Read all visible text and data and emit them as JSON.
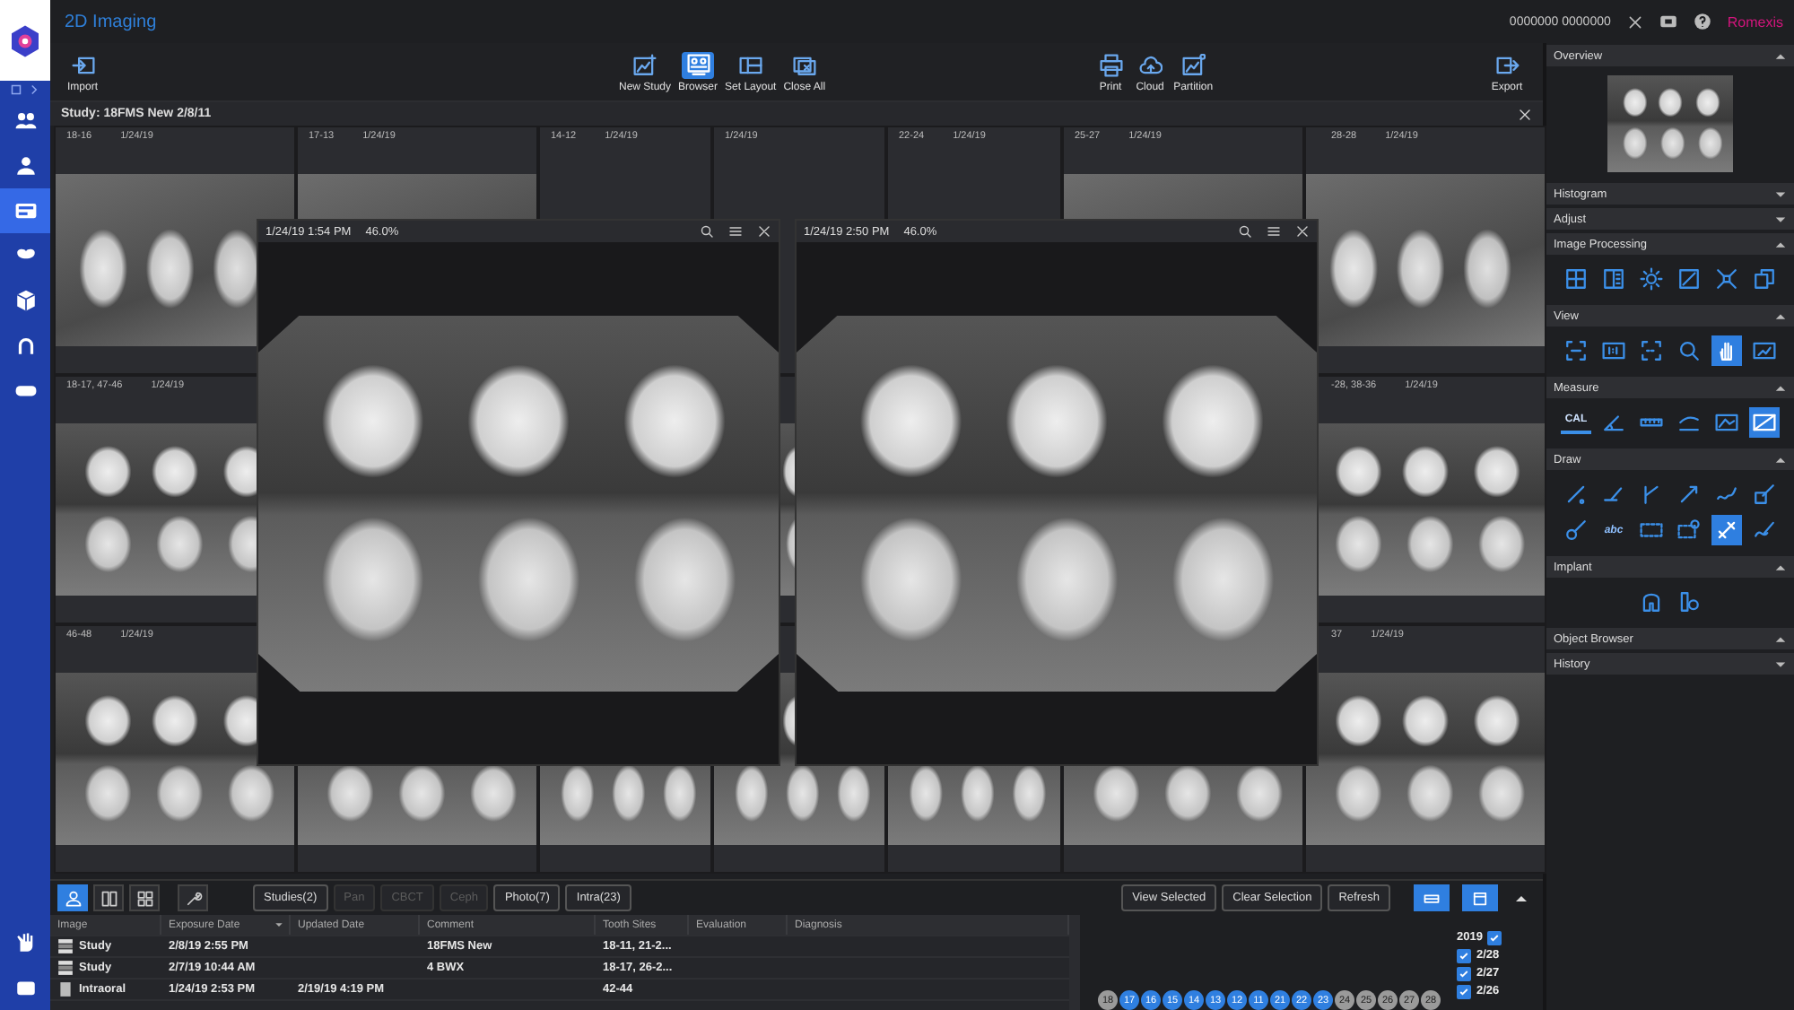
{
  "app": {
    "title": "2D Imaging",
    "user_id": "0000000 0000000",
    "brand": "Romexis"
  },
  "nav": {
    "items": [
      {
        "kind": "group",
        "selected": false
      },
      {
        "kind": "person",
        "selected": false
      },
      {
        "kind": "browser",
        "selected": true
      },
      {
        "kind": "tooth",
        "selected": false
      },
      {
        "kind": "cube",
        "selected": false
      },
      {
        "kind": "arch",
        "selected": false
      },
      {
        "kind": "scan",
        "selected": false
      }
    ],
    "footer": [
      {
        "kind": "hand",
        "selected": false
      },
      {
        "kind": "film",
        "selected": false
      }
    ]
  },
  "toolbar": {
    "groups": [
      [
        {
          "kind": "import",
          "label": "Import",
          "selected": false
        }
      ],
      [
        {
          "kind": "new-study",
          "label": "New Study",
          "selected": false
        },
        {
          "kind": "browser",
          "label": "Browser",
          "selected": true
        },
        {
          "kind": "set-layout",
          "label": "Set Layout",
          "selected": false
        },
        {
          "kind": "close-all",
          "label": "Close All",
          "selected": false
        }
      ],
      [
        {
          "kind": "print",
          "label": "Print",
          "selected": false
        },
        {
          "kind": "cloud",
          "label": "Cloud",
          "selected": false
        },
        {
          "kind": "partition",
          "label": "Partition",
          "selected": false
        }
      ],
      [
        {
          "kind": "export",
          "label": "Export",
          "selected": false
        }
      ]
    ]
  },
  "study": {
    "title": "Study: 18FMS New  2/8/11",
    "rows": [
      [
        {
          "teeth": "18-16",
          "date": "1/24/19",
          "kind": "image"
        },
        {
          "teeth": "17-13",
          "date": "1/24/19",
          "kind": "image"
        },
        {
          "teeth": "14-12",
          "date": "1/24/19",
          "kind": "empty"
        },
        {
          "date": "1/24/19",
          "kind": "empty"
        },
        {
          "teeth": "22-24",
          "date": "1/24/19",
          "kind": "empty"
        },
        {
          "teeth": "25-27",
          "date": "1/24/19",
          "kind": "image"
        },
        {
          "teeth": "28-28",
          "date": "1/24/19",
          "kind": "image"
        }
      ],
      [
        {
          "teeth": "18-17, 47-46",
          "date": "1/24/19",
          "kind": "image"
        },
        {},
        {},
        {
          "kind": "image"
        },
        {},
        {},
        {
          "teeth": "-28, 38-36",
          "date": "1/24/19",
          "kind": "image"
        }
      ],
      [
        {
          "teeth": "46-48",
          "date": "1/24/19",
          "kind": "image"
        },
        {
          "kind": "image"
        },
        {
          "kind": "image"
        },
        {
          "kind": "image"
        },
        {
          "kind": "image"
        },
        {
          "kind": "image"
        },
        {
          "teeth": "37",
          "date": "1/24/19",
          "kind": "image"
        }
      ]
    ]
  },
  "viewers": [
    {
      "date": "1/24/19 1:54 PM",
      "zoom": "46.0%"
    },
    {
      "date": "1/24/19 2:50 PM",
      "zoom": "46.0%"
    }
  ],
  "overview": {
    "title": "Overview",
    "expanded": true
  },
  "panels": [
    {
      "title": "Histogram",
      "expanded": false
    },
    {
      "title": "Adjust",
      "expanded": false
    },
    {
      "title": "Image Processing",
      "expanded": true,
      "tools": [
        {
          "kind": "filter",
          "selected": false
        },
        {
          "kind": "split",
          "selected": false
        },
        {
          "kind": "brightness",
          "selected": false
        },
        {
          "kind": "contrast",
          "selected": false
        },
        {
          "kind": "flip",
          "selected": false
        },
        {
          "kind": "layers",
          "selected": false
        }
      ]
    },
    {
      "title": "View",
      "expanded": true,
      "tools": [
        {
          "kind": "fit",
          "selected": false
        },
        {
          "kind": "actual",
          "selected": false
        },
        {
          "kind": "fitdash",
          "selected": false
        },
        {
          "kind": "zoom",
          "selected": false
        },
        {
          "kind": "hand",
          "selected": true
        },
        {
          "kind": "picture",
          "selected": false
        }
      ]
    },
    {
      "title": "Measure",
      "expanded": true,
      "tools": [
        {
          "kind": "calibrate",
          "text": "CAL",
          "selected": false
        },
        {
          "kind": "angle",
          "selected": false
        },
        {
          "kind": "ruler",
          "selected": false
        },
        {
          "kind": "profile",
          "selected": false
        },
        {
          "kind": "area",
          "selected": false
        },
        {
          "kind": "slash",
          "selected": true
        }
      ]
    },
    {
      "title": "Draw",
      "expanded": true,
      "tools": [
        {
          "kind": "pen",
          "selected": false
        },
        {
          "kind": "line",
          "selected": false
        },
        {
          "kind": "polyline",
          "selected": false
        },
        {
          "kind": "arrow",
          "selected": false
        },
        {
          "kind": "curve",
          "selected": false
        },
        {
          "kind": "rectpen",
          "selected": false
        },
        {
          "kind": "circle",
          "selected": false
        },
        {
          "kind": "text",
          "text": "abc",
          "selected": false
        },
        {
          "kind": "dashed",
          "selected": false
        },
        {
          "kind": "dashedpin",
          "selected": false
        },
        {
          "kind": "diagonal",
          "selected": true
        },
        {
          "kind": "freehand",
          "selected": false
        }
      ]
    },
    {
      "title": "Implant",
      "expanded": true,
      "tools": [
        {
          "kind": "implant",
          "selected": false
        },
        {
          "kind": "implantpin",
          "selected": false
        }
      ]
    },
    {
      "title": "Object Browser",
      "expanded": true
    },
    {
      "title": "History",
      "expanded": false
    }
  ],
  "browser": {
    "view_modes": [
      {
        "kind": "patient",
        "selected": true
      },
      {
        "kind": "grid2",
        "selected": false
      },
      {
        "kind": "grid4",
        "selected": false
      },
      {
        "kind": "tools",
        "selected": false
      }
    ],
    "filters": [
      {
        "label": "Studies(2)",
        "disabled": false
      },
      {
        "label": "Pan",
        "disabled": true
      },
      {
        "label": "CBCT",
        "disabled": true
      },
      {
        "label": "Ceph",
        "disabled": true
      },
      {
        "label": "Photo(7)",
        "disabled": false
      },
      {
        "label": "Intra(23)",
        "disabled": false
      }
    ],
    "actions": [
      "View Selected",
      "Clear Selection",
      "Refresh"
    ],
    "layout_buttons": [
      {
        "kind": "rows"
      },
      {
        "kind": "window"
      }
    ],
    "columns": [
      {
        "label": "Image",
        "sorted": false
      },
      {
        "label": "Exposure Date",
        "sorted": true
      },
      {
        "label": "Updated Date",
        "sorted": false
      },
      {
        "label": "Comment",
        "sorted": false
      },
      {
        "label": "Tooth Sites",
        "sorted": false
      },
      {
        "label": "Evaluation",
        "sorted": false
      },
      {
        "label": "Diagnosis",
        "sorted": false
      }
    ],
    "rows": [
      {
        "kind": "study",
        "image": "Study",
        "exposure": "2/8/19 2:55 PM",
        "updated": "",
        "comment": "18FMS New",
        "teeth": "18-11, 21-2..."
      },
      {
        "kind": "study",
        "image": "Study",
        "exposure": "2/7/19 10:44 AM",
        "updated": "",
        "comment": "4 BWX",
        "teeth": "18-17, 26-2..."
      },
      {
        "kind": "intraoral",
        "image": "Intraoral",
        "exposure": "1/24/19 2:53 PM",
        "updated": "2/19/19 4:19 PM",
        "comment": "",
        "teeth": "42-44"
      }
    ],
    "teeth": [
      {
        "label": "18",
        "selected": false
      },
      {
        "label": "17",
        "selected": true
      },
      {
        "label": "16",
        "selected": true
      },
      {
        "label": "15",
        "selected": true
      },
      {
        "label": "14",
        "selected": true
      },
      {
        "label": "13",
        "selected": true
      },
      {
        "label": "12",
        "selected": true
      },
      {
        "label": "11",
        "selected": true
      },
      {
        "label": "21",
        "selected": true
      },
      {
        "label": "22",
        "selected": true
      },
      {
        "label": "23",
        "selected": true
      },
      {
        "label": "24",
        "selected": false
      },
      {
        "label": "25",
        "selected": false
      },
      {
        "label": "26",
        "selected": false
      },
      {
        "label": "27",
        "selected": false
      },
      {
        "label": "28",
        "selected": false
      }
    ],
    "dates": [
      {
        "label": "2019",
        "checked": true
      },
      {
        "label": "2/28",
        "checked": true
      },
      {
        "label": "2/27",
        "checked": true
      },
      {
        "label": "2/26",
        "checked": true
      }
    ]
  }
}
